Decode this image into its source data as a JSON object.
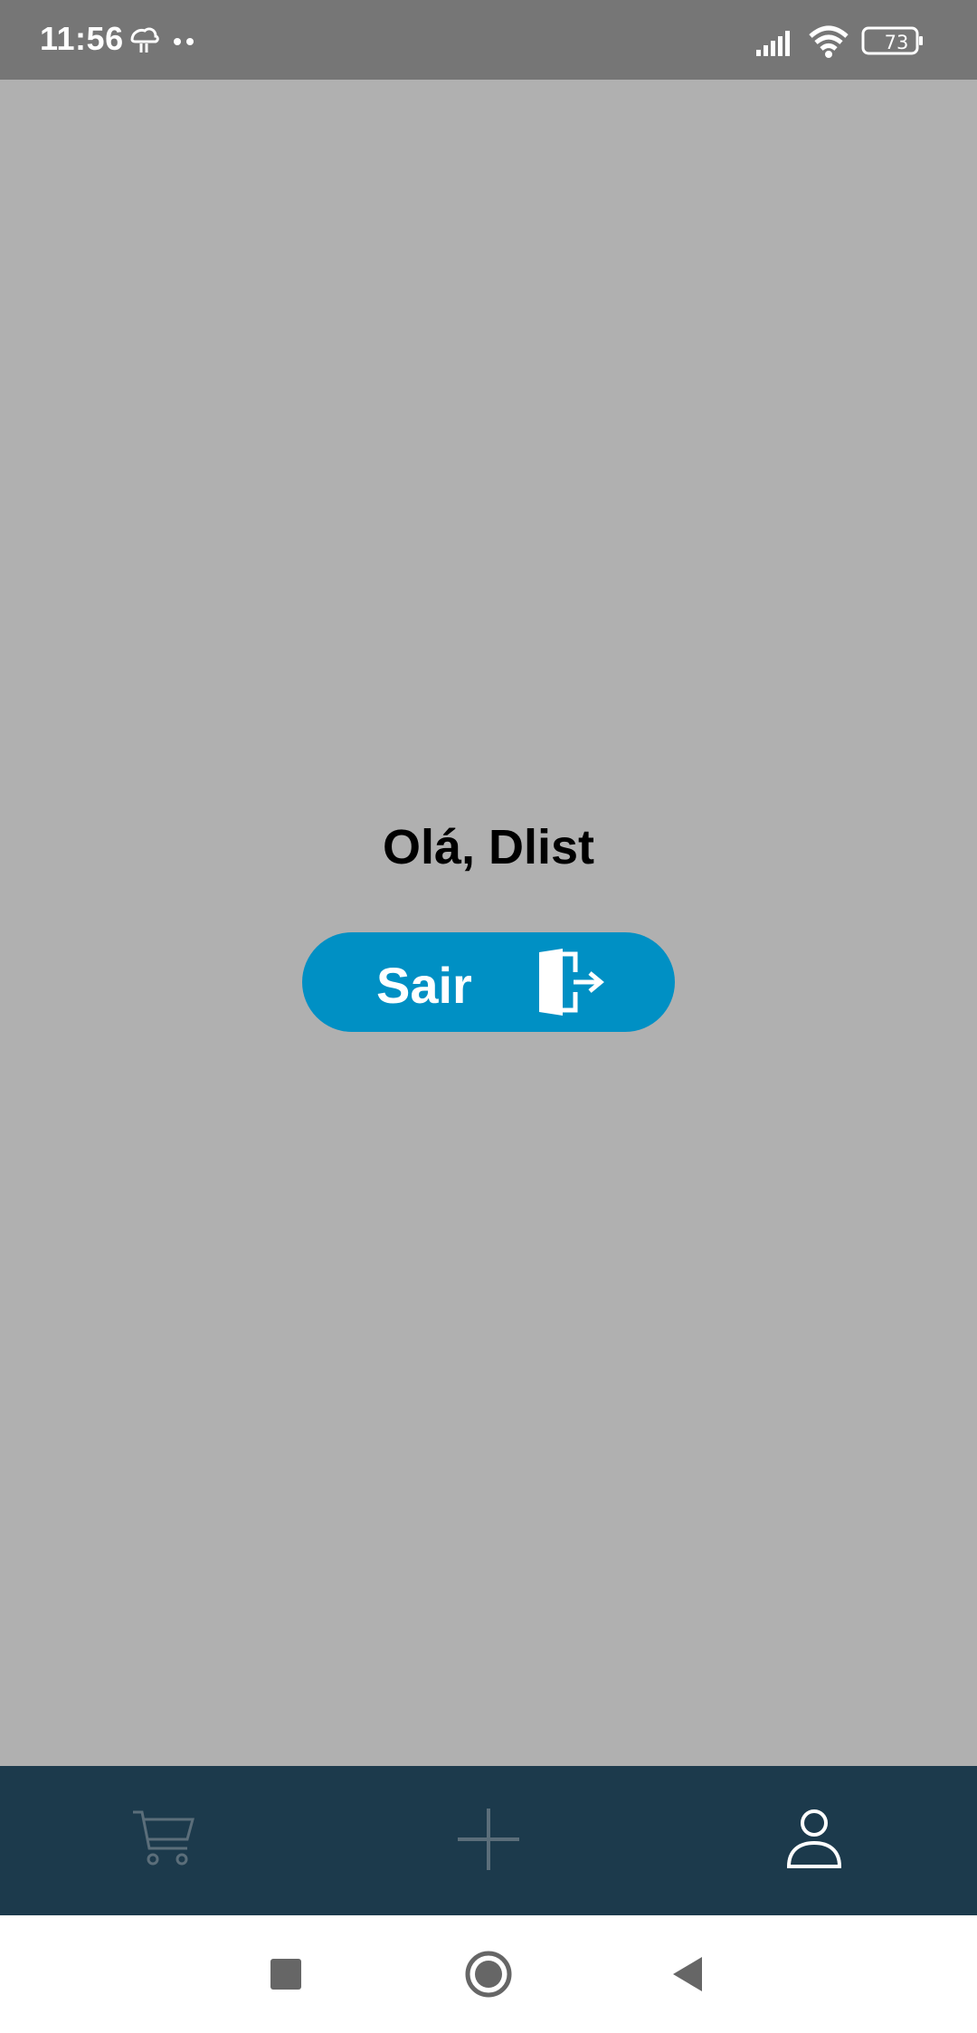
{
  "status_bar": {
    "time": "11:56",
    "battery_level": "73",
    "icons": [
      "cloud-icon",
      "dots-icon",
      "signal-icon",
      "wifi-icon",
      "battery-icon"
    ]
  },
  "profile": {
    "greeting": "Olá, Dlist"
  },
  "logout": {
    "label": "Sair",
    "icon": "logout-door-icon",
    "color": "#0090c4"
  },
  "bottom_nav": {
    "background": "#1c3a4c",
    "items": [
      {
        "name": "cart",
        "icon": "cart-icon",
        "active": false
      },
      {
        "name": "add",
        "icon": "plus-icon",
        "active": false
      },
      {
        "name": "profile",
        "icon": "person-icon",
        "active": true
      }
    ]
  },
  "system_nav": {
    "buttons": [
      "recents-square-icon",
      "home-circle-icon",
      "back-triangle-icon"
    ]
  }
}
